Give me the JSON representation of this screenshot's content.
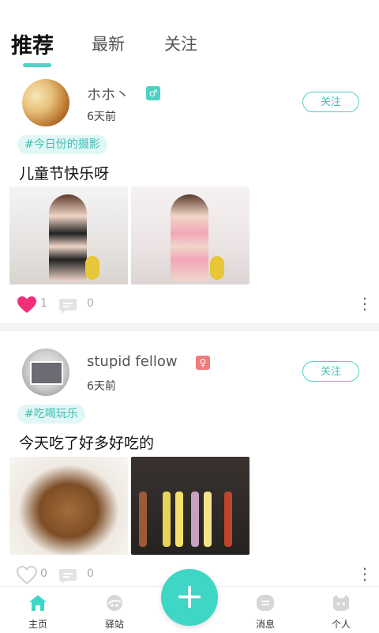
{
  "tabs": [
    {
      "label": "推荐",
      "active": true
    },
    {
      "label": "最新",
      "active": false
    },
    {
      "label": "关注",
      "active": false
    }
  ],
  "posts": [
    {
      "username": "ホホ丶",
      "gender": "♂",
      "time": "6天前",
      "follow_label": "关注",
      "tag": "#今日份的摄影",
      "caption": "儿童节快乐呀",
      "likes": "1",
      "comments": "0",
      "liked": true
    },
    {
      "username": "stupid fellow",
      "gender": "♀",
      "time": "6天前",
      "follow_label": "关注",
      "tag": "#吃喝玩乐",
      "caption": "今天吃了好多好吃的",
      "likes": "0",
      "comments": "0",
      "liked": false
    }
  ],
  "nav": {
    "home": "主页",
    "station": "驿站",
    "messages": "消息",
    "profile": "个人",
    "fab_symbol": "+"
  },
  "colors": {
    "accent": "#3ed6c4",
    "like": "#f0307a",
    "female": "#f07c7c"
  }
}
